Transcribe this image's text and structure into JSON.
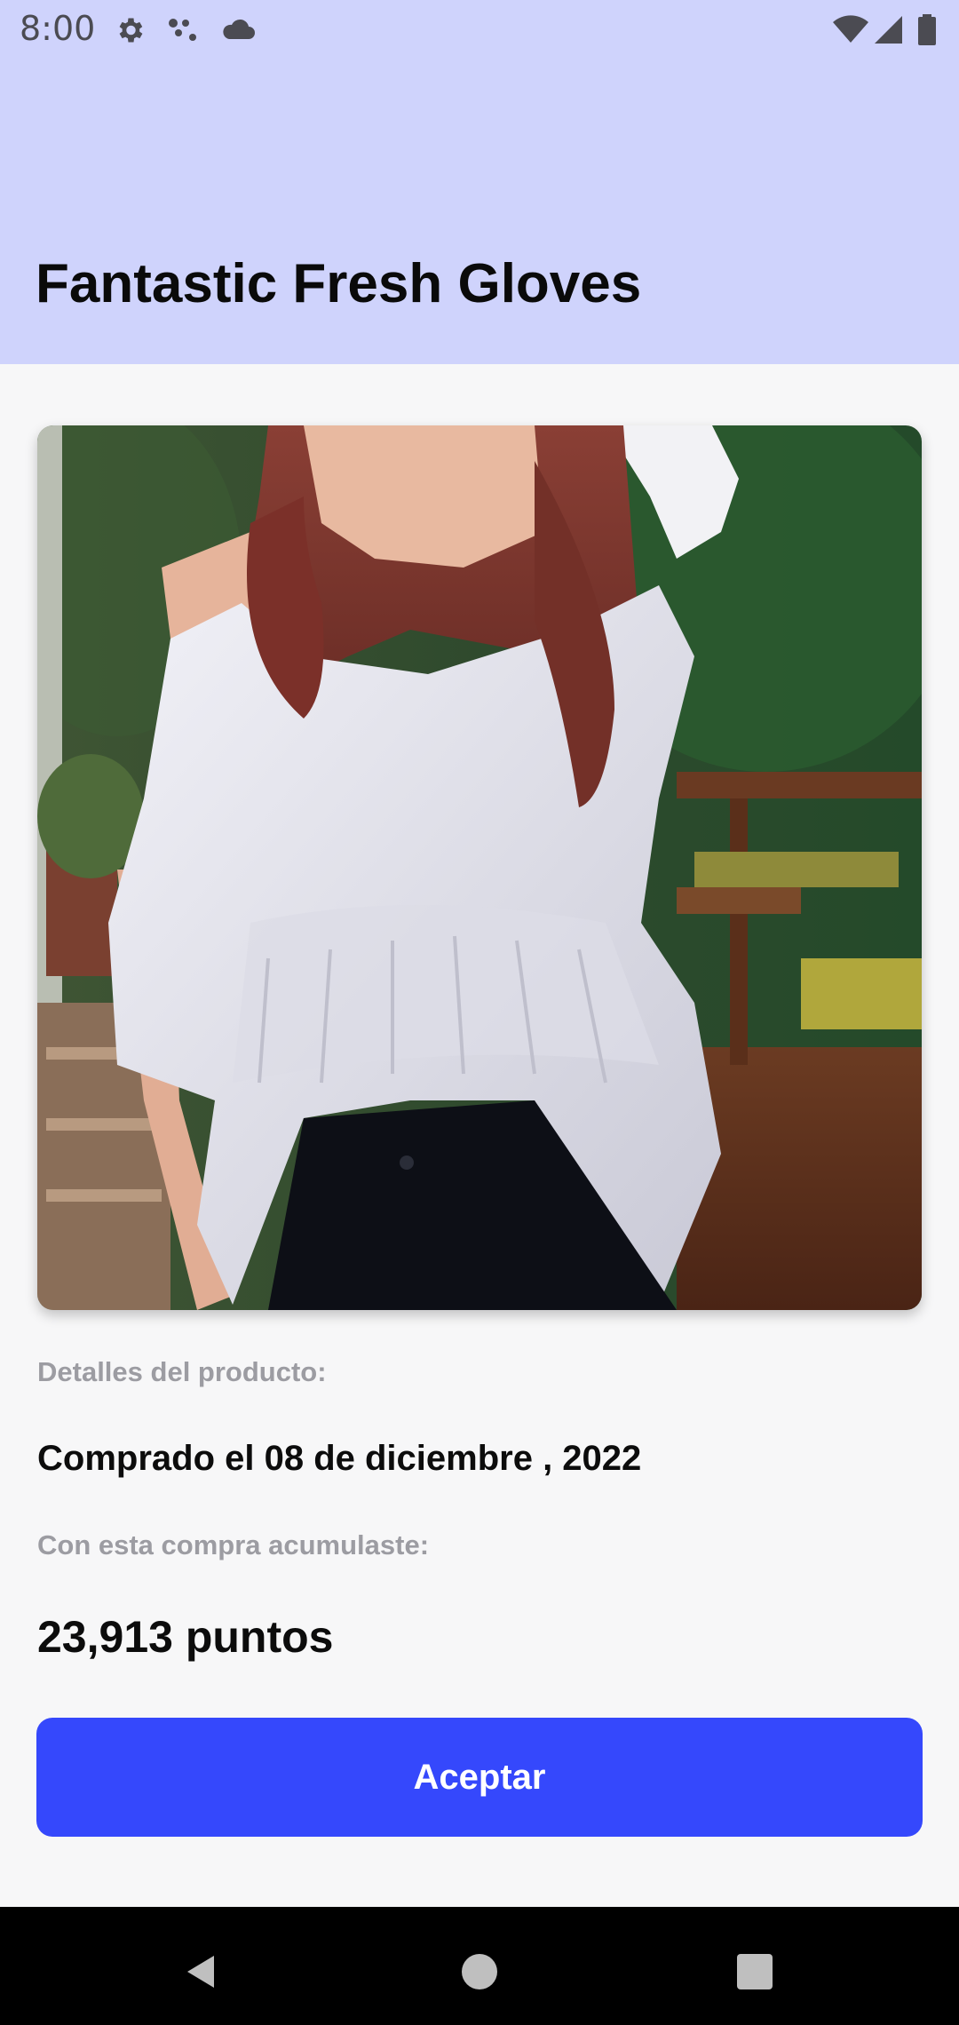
{
  "status_bar": {
    "time": "8:00",
    "left_icons": [
      "gear-icon",
      "dots-icon",
      "cloud-icon"
    ],
    "right_icons": [
      "wifi-icon",
      "signal-icon",
      "battery-icon"
    ]
  },
  "toolbar": {
    "title": "Fantastic Fresh Gloves"
  },
  "product": {
    "image_description_icon": "product-photo",
    "details_label": "Detalles del producto:",
    "purchase_date": "Comprado el 08 de diciembre , 2022",
    "points_label": "Con esta compra acumulaste:",
    "points": "23,913 puntos"
  },
  "actions": {
    "accept_label": "Aceptar"
  },
  "navigation": {
    "buttons": [
      "back-icon",
      "home-icon",
      "recents-icon"
    ]
  },
  "colors": {
    "header_bg": "#cfd3fc",
    "page_bg": "#f7f7f8",
    "accent": "#3548fc",
    "muted_text": "#9c9ca2"
  }
}
